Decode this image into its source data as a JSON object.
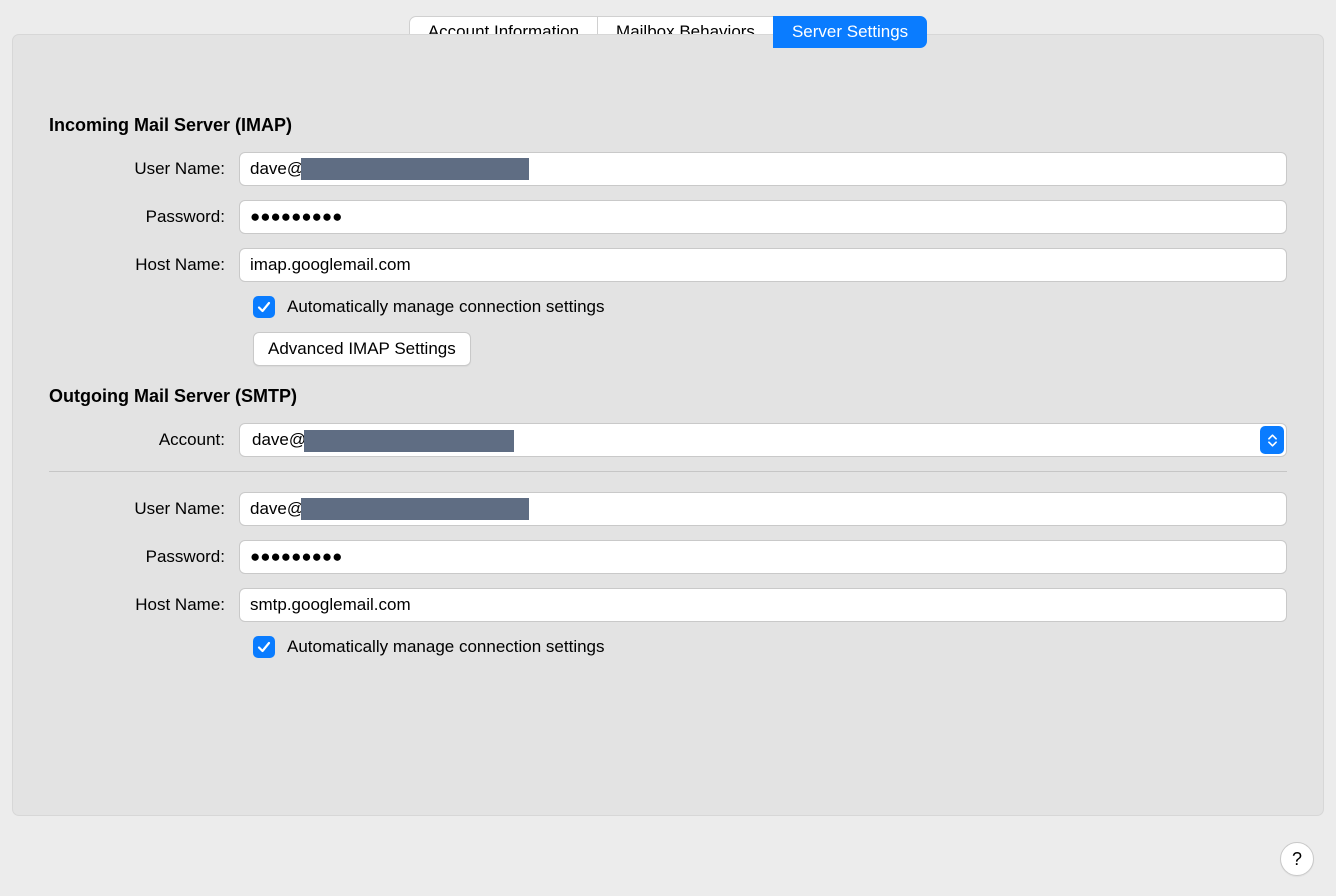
{
  "tabs": {
    "account_info": "Account Information",
    "mailbox_behaviors": "Mailbox Behaviors",
    "server_settings": "Server Settings"
  },
  "incoming": {
    "title": "Incoming Mail Server (IMAP)",
    "username_label": "User Name:",
    "username_value": "dave@",
    "password_label": "Password:",
    "password_value": "●●●●●●●●●",
    "hostname_label": "Host Name:",
    "hostname_value": "imap.googlemail.com",
    "auto_manage": "Automatically manage connection settings",
    "advanced_button": "Advanced IMAP Settings"
  },
  "outgoing": {
    "title": "Outgoing Mail Server (SMTP)",
    "account_label": "Account:",
    "account_value": "dave@",
    "username_label": "User Name:",
    "username_value": "dave@",
    "password_label": "Password:",
    "password_value": "●●●●●●●●●",
    "hostname_label": "Host Name:",
    "hostname_value": "smtp.googlemail.com",
    "auto_manage": "Automatically manage connection settings"
  },
  "help": "?"
}
